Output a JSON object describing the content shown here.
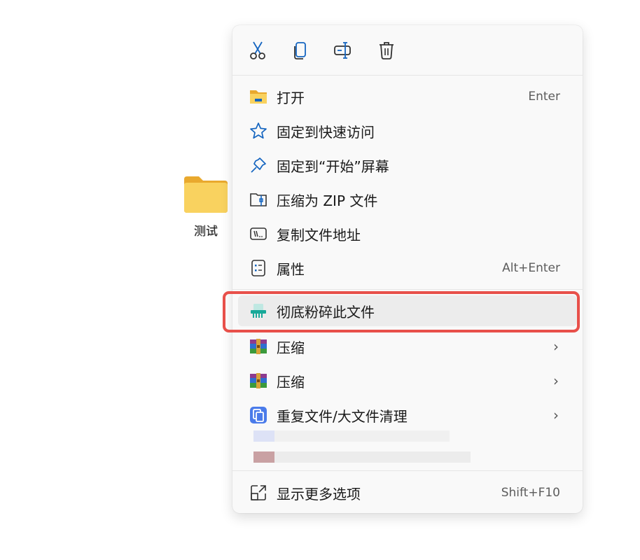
{
  "desktop": {
    "folder_label": "测试"
  },
  "toolbar": [
    {
      "name": "cut",
      "icon": "scissors-icon"
    },
    {
      "name": "copy",
      "icon": "copy-icon"
    },
    {
      "name": "rename",
      "icon": "rename-icon"
    },
    {
      "name": "delete",
      "icon": "trash-icon"
    }
  ],
  "menu": {
    "items": [
      {
        "label": "打开",
        "shortcut": "Enter",
        "icon": "folder-icon"
      },
      {
        "label": "固定到快速访问",
        "icon": "star-icon"
      },
      {
        "label": "固定到“开始”屏幕",
        "icon": "pin-icon"
      },
      {
        "label": "压缩为 ZIP 文件",
        "icon": "zip-icon"
      },
      {
        "label": "复制文件地址",
        "icon": "path-icon"
      },
      {
        "label": "属性",
        "shortcut": "Alt+Enter",
        "icon": "properties-icon"
      },
      {
        "label": "彻底粉碎此文件",
        "icon": "shredder-icon"
      },
      {
        "label": "压缩",
        "icon": "winrar-icon"
      },
      {
        "label": "压缩",
        "icon": "winrar-icon"
      },
      {
        "label": "重复文件/大文件清理",
        "icon": "duplicate-cleaner-icon"
      },
      {
        "label": "显示更多选项",
        "shortcut": "Shift+F10",
        "icon": "more-options-icon"
      }
    ]
  },
  "colors": {
    "highlight_border": "#e8504a",
    "accent_blue": "#1565c0",
    "folder_yellow": "#f7c948"
  }
}
